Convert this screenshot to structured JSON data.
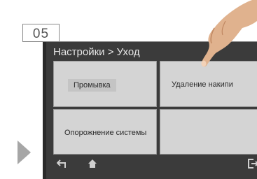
{
  "step": {
    "number": "05"
  },
  "screen": {
    "breadcrumb": "Настройки > Уход",
    "tiles": [
      {
        "label": "Промывка"
      },
      {
        "label": "Удаление накипи"
      },
      {
        "label": "Опорожнение системы"
      },
      {
        "label": ""
      }
    ],
    "icons": {
      "back": "back-arrow-icon",
      "home": "home-icon",
      "exit": "exit-icon"
    }
  },
  "colors": {
    "screen_bg": "#3b3b3b",
    "tile_bg": "#d4d4d4",
    "arrow": "#a6a6a6"
  }
}
